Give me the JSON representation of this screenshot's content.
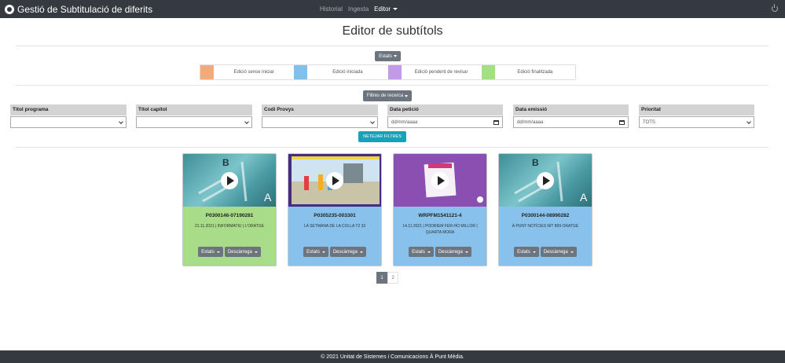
{
  "app": {
    "title": "Gestió de Subtitulació de diferits"
  },
  "nav": {
    "items": [
      {
        "label": "Historial"
      },
      {
        "label": "Ingesta"
      },
      {
        "label": "Editor"
      }
    ]
  },
  "page": {
    "title": "Editor de subtítols"
  },
  "states_button": {
    "label": "Estats"
  },
  "legend": {
    "items": [
      {
        "label": "Edició sense iniciar",
        "color": "#f5a878"
      },
      {
        "label": "Edició iniciada",
        "color": "#82c0ec"
      },
      {
        "label": "Edició pendent de revisar",
        "color": "#c39ae8"
      },
      {
        "label": "Edició finalitzada",
        "color": "#a3e082"
      }
    ]
  },
  "filters_button": {
    "label": "Filtres de recerca"
  },
  "filters": [
    {
      "label": "Títol programa",
      "value": ""
    },
    {
      "label": "Títol capítol",
      "value": ""
    },
    {
      "label": "Codi Provys",
      "value": ""
    },
    {
      "label": "Data petició",
      "value": "dd/mm/aaaa"
    },
    {
      "label": "Data emissió",
      "value": "dd/mm/aaaa"
    },
    {
      "label": "Prioritat",
      "value": "TOTS"
    }
  ],
  "clear_button": {
    "label": "NETEJAR FILTRES"
  },
  "cards": [
    {
      "code": "P0300146-07190281",
      "desc": "21.11.2021 | INFORMATIU | L'ORATGE",
      "status_color": "#a8dc88",
      "thumb": "teal",
      "states_label": "Estats",
      "download_label": "Descàrrega"
    },
    {
      "code": "P0305235-003301",
      "desc": "LA SETMANA DE LA COLLA T2 33",
      "status_color": "#88c2ec",
      "thumb": "beach",
      "states_label": "Estats",
      "download_label": "Descàrrega"
    },
    {
      "code": "WRPFM1541121-4",
      "desc": "14.11.2021 | PODRIEM FER-HO MILLOR | QUARTA MORA",
      "status_color": "#88c2ec",
      "thumb": "purple",
      "states_label": "Estats",
      "download_label": "Descàrrega"
    },
    {
      "code": "P0300144-08990282",
      "desc": "À PUNT NOTÍCIES NIT 899 ORATGE",
      "status_color": "#88c2ec",
      "thumb": "teal",
      "states_label": "Estats",
      "download_label": "Descàrrega"
    }
  ],
  "pagination": {
    "pages": [
      "1",
      "2"
    ],
    "current": "1"
  },
  "footer": {
    "text": "© 2021 Unitat de Sistemes i Comunicacions À Punt Mèdia."
  }
}
